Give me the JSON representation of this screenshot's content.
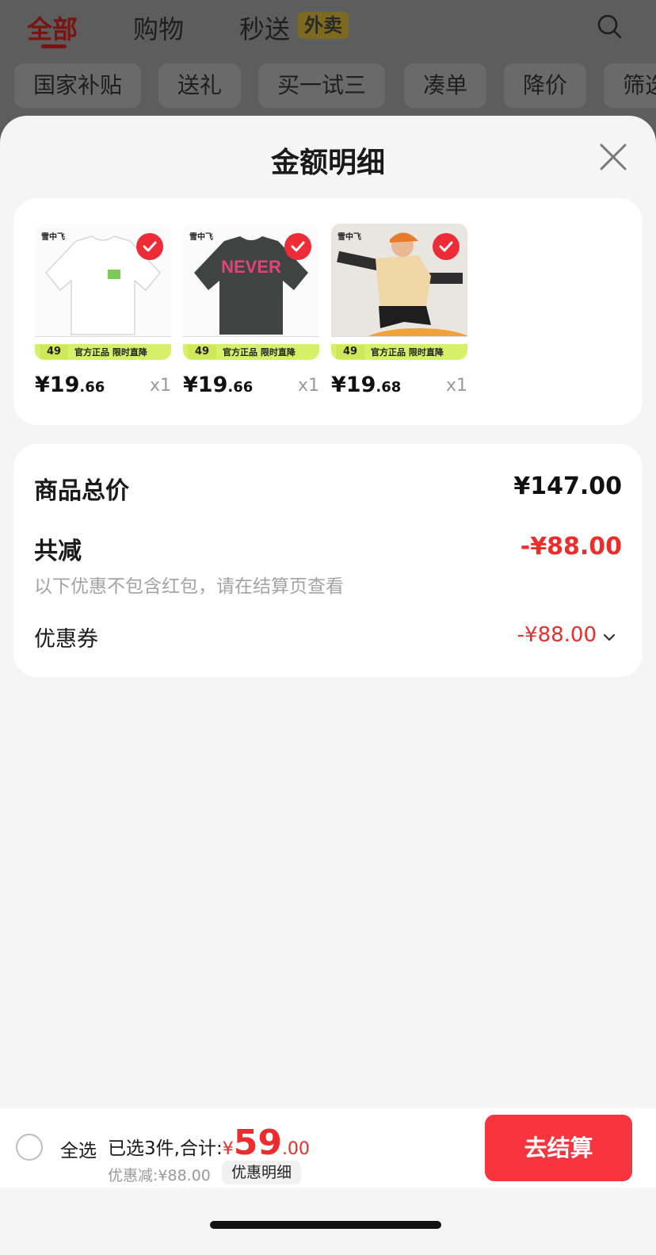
{
  "tabs": {
    "all": "全部",
    "shopping": "购物",
    "flash": "秒送",
    "takeout_badge": "外卖"
  },
  "chips": [
    "国家补贴",
    "送礼",
    "买一试三",
    "凑单",
    "降价",
    "筛选"
  ],
  "sheet": {
    "title": "金额明细"
  },
  "products": [
    {
      "brand": "雪中飞",
      "strip_price": "49",
      "strip_text": "官方正品 限时直降",
      "price_int": "¥19",
      "price_dec": ".66",
      "qty": "x1"
    },
    {
      "brand": "雪中飞",
      "strip_price": "49",
      "strip_text": "官方正品 限时直降",
      "price_int": "¥19",
      "price_dec": ".66",
      "qty": "x1"
    },
    {
      "brand": "雪中飞",
      "strip_price": "49",
      "strip_text": "官方正品 限时直降",
      "price_int": "¥19",
      "price_dec": ".68",
      "qty": "x1"
    }
  ],
  "summary": {
    "total_label": "商品总价",
    "total_value": "¥147.00",
    "reduce_label": "共减",
    "reduce_value": "-¥88.00",
    "note": "以下优惠不包含红包，请在结算页查看",
    "coupon_label": "优惠券",
    "coupon_value": "-¥88.00"
  },
  "bottom": {
    "select_all": "全选",
    "selected_text": "已选3件,合计:",
    "yen": "¥",
    "total_int": "59",
    "total_dec": ".00",
    "discount_text": "优惠减:¥88.00",
    "detail_button": "优惠明细",
    "checkout_button": "去结算"
  },
  "colors": {
    "accent_red": "#f8343e",
    "price_red": "#ee2c2c"
  },
  "icons": {
    "search": "search-icon",
    "close": "close-icon",
    "check": "check-icon",
    "chevron": "chevron-down-icon"
  }
}
